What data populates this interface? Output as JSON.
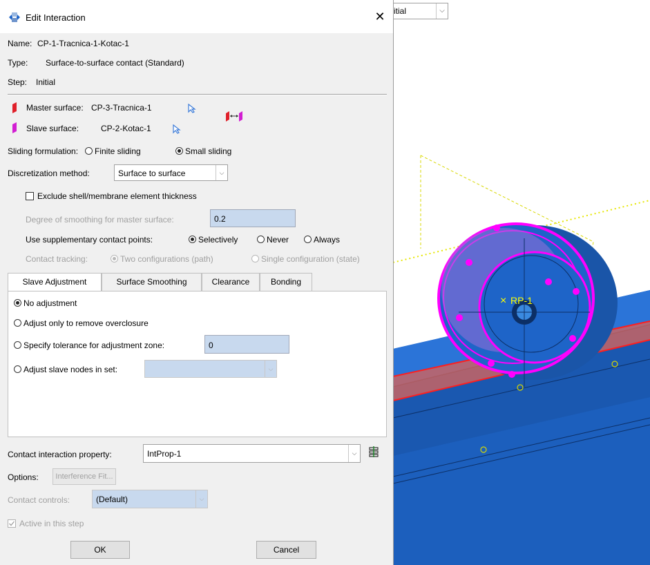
{
  "window": {
    "title": "Edit Interaction",
    "close_glyph": "✕"
  },
  "background_step_combo": {
    "value": "itial"
  },
  "info": {
    "name_label": "Name:",
    "name_value": "CP-1-Tracnica-1-Kotac-1",
    "type_label": "Type:",
    "type_value": "Surface-to-surface contact (Standard)",
    "step_label": "Step:",
    "step_value": "Initial"
  },
  "surfaces": {
    "master_label": "Master surface:",
    "master_value": "CP-3-Tracnica-1",
    "slave_label": "Slave surface:",
    "slave_value": "CP-2-Kotac-1",
    "master_color": "#e0202a",
    "slave_color": "#d21ed2",
    "select_icon": "cursor-arrow-icon",
    "swap_icon": "swap-surfaces-icon"
  },
  "sliding": {
    "label": "Sliding formulation:",
    "options": [
      "Finite sliding",
      "Small sliding"
    ],
    "selected": "Small sliding"
  },
  "discretization": {
    "label": "Discretization method:",
    "value": "Surface to surface"
  },
  "exclude_shell": {
    "label": "Exclude shell/membrane element thickness",
    "checked": false
  },
  "smoothing": {
    "label": "Degree of smoothing for master surface:",
    "value": "0.2"
  },
  "supplementary": {
    "label": "Use supplementary contact points:",
    "options": [
      "Selectively",
      "Never",
      "Always"
    ],
    "selected": "Selectively"
  },
  "tracking": {
    "label": "Contact tracking:",
    "options": [
      "Two configurations (path)",
      "Single configuration (state)"
    ],
    "selected": "Two configurations (path)"
  },
  "tabs": [
    {
      "label": "Slave Adjustment",
      "active": true
    },
    {
      "label": "Surface Smoothing",
      "active": false
    },
    {
      "label": "Clearance",
      "active": false
    },
    {
      "label": "Bonding",
      "active": false
    }
  ],
  "slave_adjustment": {
    "options": {
      "none": "No adjustment",
      "overclosure": "Adjust only to remove overclosure",
      "tolerance": "Specify tolerance for adjustment zone:",
      "set": "Adjust slave nodes in set:"
    },
    "selected": "No adjustment",
    "tolerance_value": "0",
    "set_value": ""
  },
  "property": {
    "label": "Contact interaction property:",
    "value": "IntProp-1",
    "create_icon": "create-property-icon"
  },
  "options_row": {
    "label": "Options:",
    "button": "Interference Fit..."
  },
  "controls": {
    "label": "Contact controls:",
    "value": "(Default)"
  },
  "active_step": {
    "label": "Active in this step",
    "checked": true
  },
  "buttons": {
    "ok": "OK",
    "cancel": "Cancel"
  },
  "viewport": {
    "reference_point_label": "RP-1",
    "part_color": "#1e64c8"
  }
}
